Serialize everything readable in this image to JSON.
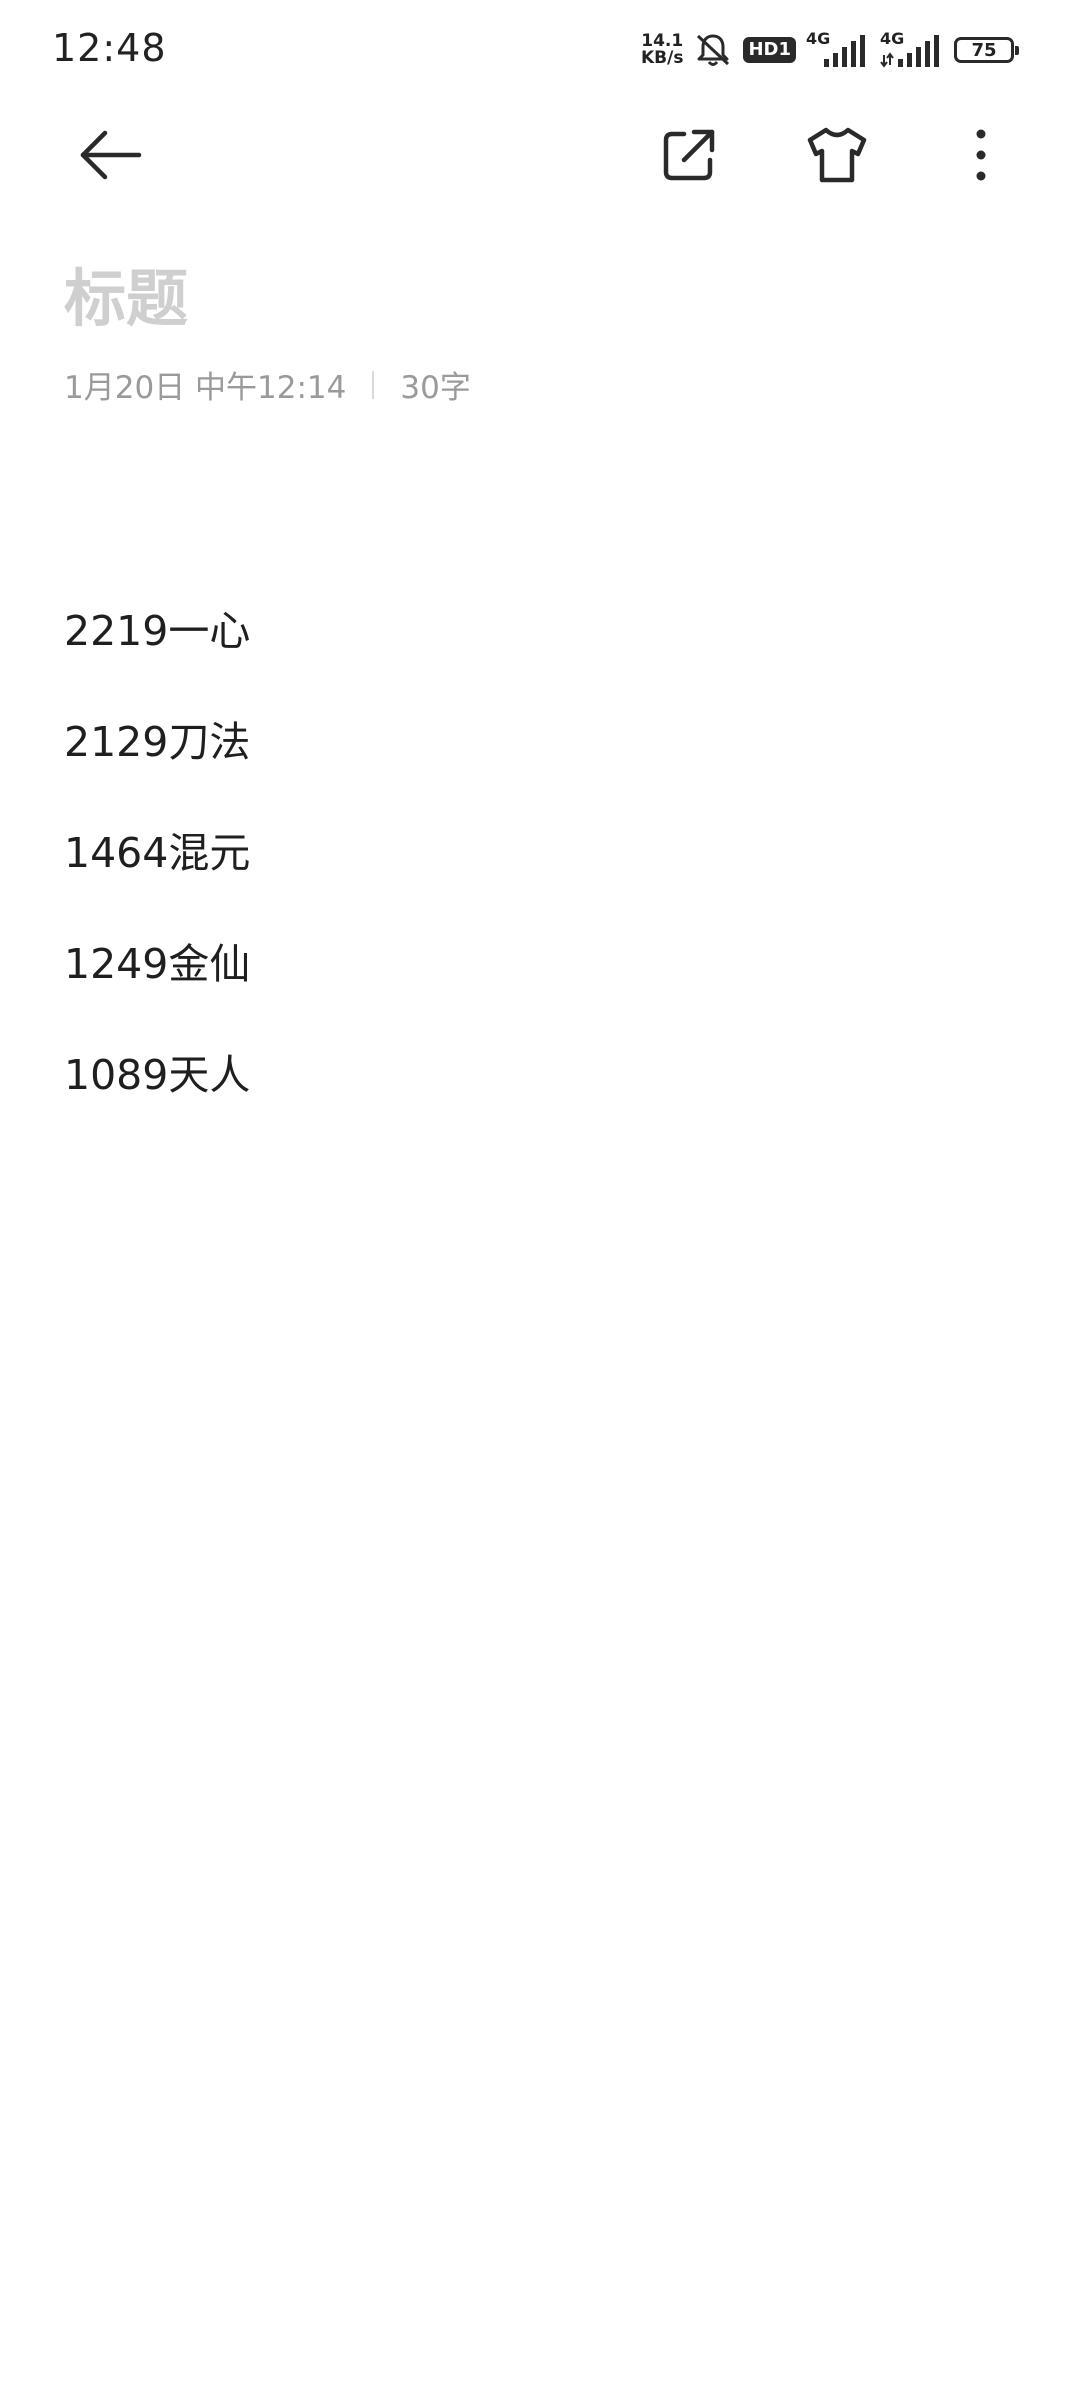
{
  "status_bar": {
    "time": "12:48",
    "net_speed_value": "14.1",
    "net_speed_unit": "KB/s",
    "hd_badge": "HD1",
    "network_1": "4G",
    "network_2": "4G",
    "battery": "75",
    "icons": [
      "mute-bell-icon",
      "signal-icon",
      "signal-icon",
      "battery-icon"
    ]
  },
  "toolbar": {
    "icons": [
      "back-arrow-icon",
      "share-external-icon",
      "tshirt-theme-icon",
      "more-vertical-icon"
    ]
  },
  "note": {
    "title_placeholder": "标题",
    "date": "1月20日 中午12:14",
    "word_count": "30字",
    "lines": [
      "2219一心",
      "2129刀法",
      "1464混元",
      "1249金仙",
      "1089天人"
    ]
  },
  "colors": {
    "background": "#ffffff",
    "text": "#1f1f1f",
    "placeholder": "#cfcfcf",
    "meta": "#9a9a9a"
  }
}
